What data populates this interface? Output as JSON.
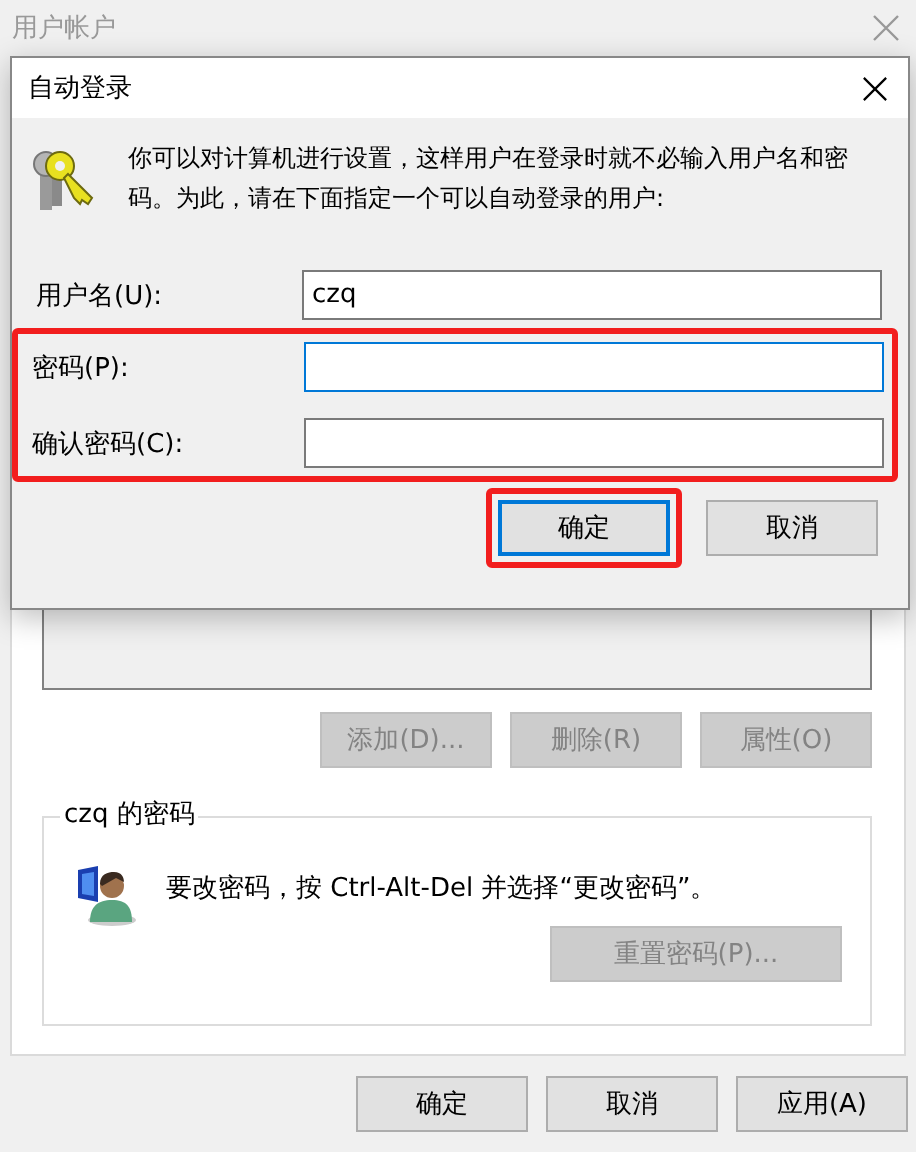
{
  "window": {
    "title": "用户帐户",
    "active": false
  },
  "list_buttons": [
    {
      "label": "添加(D)...",
      "disabled": true
    },
    {
      "label": "删除(R)",
      "disabled": true
    },
    {
      "label": "属性(O)",
      "disabled": true
    }
  ],
  "password_group": {
    "title": "czq 的密码",
    "text": "要改密码，按 Ctrl-Alt-Del 并选择“更改密码”。",
    "button": {
      "label": "重置密码(P)...",
      "disabled": true
    }
  },
  "footer_buttons": [
    {
      "label": "确定",
      "disabled": false
    },
    {
      "label": "取消",
      "disabled": false
    },
    {
      "label": "应用(A)",
      "disabled": false
    }
  ],
  "dialog": {
    "title": "自动登录",
    "message": "你可以对计算机进行设置，这样用户在登录时就不必输入用户名和密码。为此，请在下面指定一个可以自动登录的用户:",
    "fields": [
      {
        "label": "用户名(U):",
        "value": "czq",
        "focused": false,
        "highlighted": false
      },
      {
        "label": "密码(P):",
        "focused": true,
        "highlighted": true
      },
      {
        "label": "确认密码(C):",
        "focused": false,
        "highlighted": true
      }
    ],
    "buttons": [
      {
        "label": "确定",
        "default": true,
        "highlighted": true
      },
      {
        "label": "取消",
        "default": false,
        "highlighted": false
      }
    ]
  }
}
